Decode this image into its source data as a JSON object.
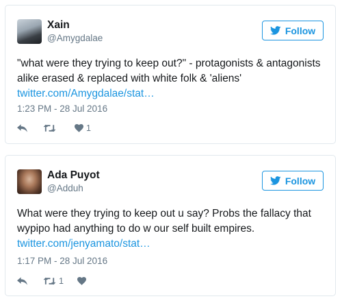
{
  "tweets": [
    {
      "display_name": "Xain",
      "screen_name": "@Amygdalae",
      "follow_label": "Follow",
      "text": "\"what were they trying to keep out?\" - protagonists & antagonists alike erased & replaced with white folk & 'aliens' ",
      "link": "twitter.com/Amygdalae/stat…",
      "timestamp": "1:23 PM - 28 Jul 2016",
      "retweet_count": "",
      "like_count": "1"
    },
    {
      "display_name": "Ada Puyot",
      "screen_name": "@Adduh",
      "follow_label": "Follow",
      "text": "What were they trying to keep out u say? Probs the fallacy that wypipo had anything to do w our self built empires. ",
      "link": "twitter.com/jenyamato/stat…",
      "timestamp": "1:17 PM - 28 Jul 2016",
      "retweet_count": "1",
      "like_count": ""
    }
  ],
  "icons": {
    "follow": "twitter-bird-icon",
    "reply": "reply-icon",
    "retweet": "retweet-icon",
    "like": "heart-icon"
  },
  "colors": {
    "link": "#1b95e0",
    "muted": "#657786",
    "text": "#14171a",
    "border": "#e1e8ed"
  }
}
